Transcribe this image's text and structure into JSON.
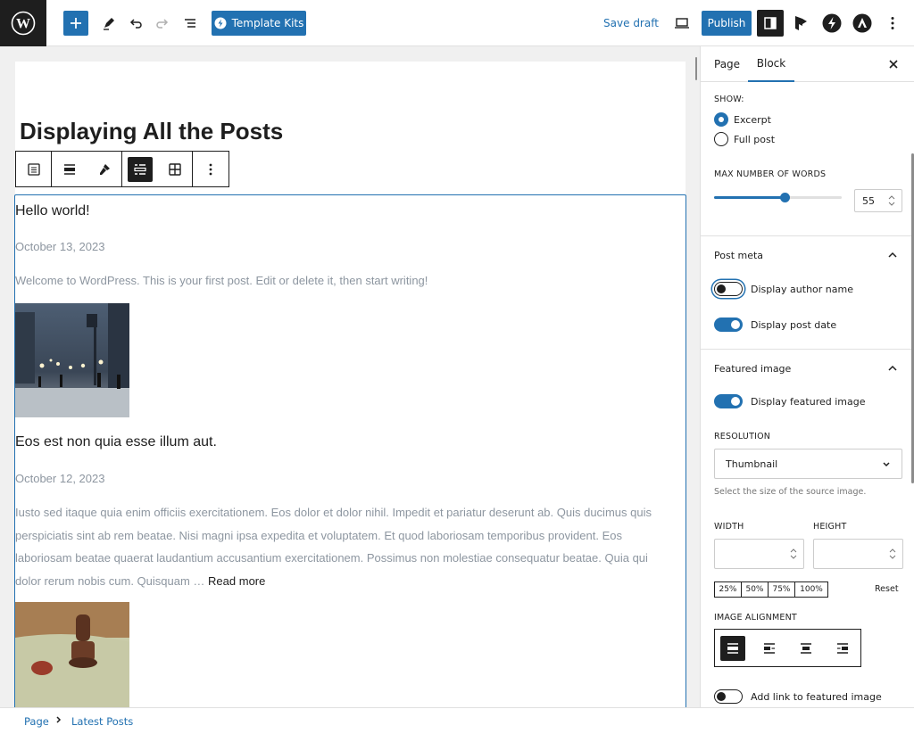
{
  "topbar": {
    "template_kits_label": "Template Kits",
    "save_draft_label": "Save draft",
    "publish_label": "Publish"
  },
  "editor": {
    "page_title": "Displaying All the Posts",
    "posts": [
      {
        "title": "Hello world!",
        "date": "October 13, 2023",
        "excerpt": "Welcome to WordPress. This is your first post. Edit or delete it, then start writing!"
      },
      {
        "title": "Eos est non quia esse illum aut.",
        "date": "October 12, 2023",
        "excerpt": "Iusto sed itaque quia enim officiis exercitationem. Eos dolor et dolor nihil. Impedit et pariatur deserunt ab. Quis ducimus quis perspiciatis sint ab rem beatae. Nisi magni ipsa expedita et voluptatem. Et quod laboriosam temporibus provident. Eos laboriosam beatae quaerat laudantium accusantium exercitationem. Possimus non molestiae consequatur beatae. Quia qui dolor rerum nobis cum. Quisquam …",
        "read_more": "Read more"
      }
    ]
  },
  "sidebar": {
    "tabs": [
      "Page",
      "Block"
    ],
    "active_tab": "Block",
    "show_label": "SHOW:",
    "show_options": [
      "Excerpt",
      "Full post"
    ],
    "show_selected": "Excerpt",
    "max_words_label": "MAX NUMBER OF WORDS",
    "max_words_value": "55",
    "max_words_max": 100,
    "post_meta": {
      "title": "Post meta",
      "author_label": "Display author name",
      "author_on": false,
      "date_label": "Display post date",
      "date_on": true
    },
    "featured_image": {
      "title": "Featured image",
      "display_label": "Display featured image",
      "display_on": true,
      "resolution_label": "RESOLUTION",
      "resolution_value": "Thumbnail",
      "resolution_help": "Select the size of the source image.",
      "width_label": "WIDTH",
      "height_label": "HEIGHT",
      "percent_options": [
        "25%",
        "50%",
        "75%",
        "100%"
      ],
      "reset_label": "Reset",
      "alignment_label": "IMAGE ALIGNMENT",
      "link_label": "Add link to featured image",
      "link_on": false
    }
  },
  "breadcrumb": [
    "Page",
    "Latest Posts"
  ],
  "colors": {
    "accent": "#2271b1",
    "dark": "#1e1e1e",
    "muted_text": "#8d96a0"
  }
}
